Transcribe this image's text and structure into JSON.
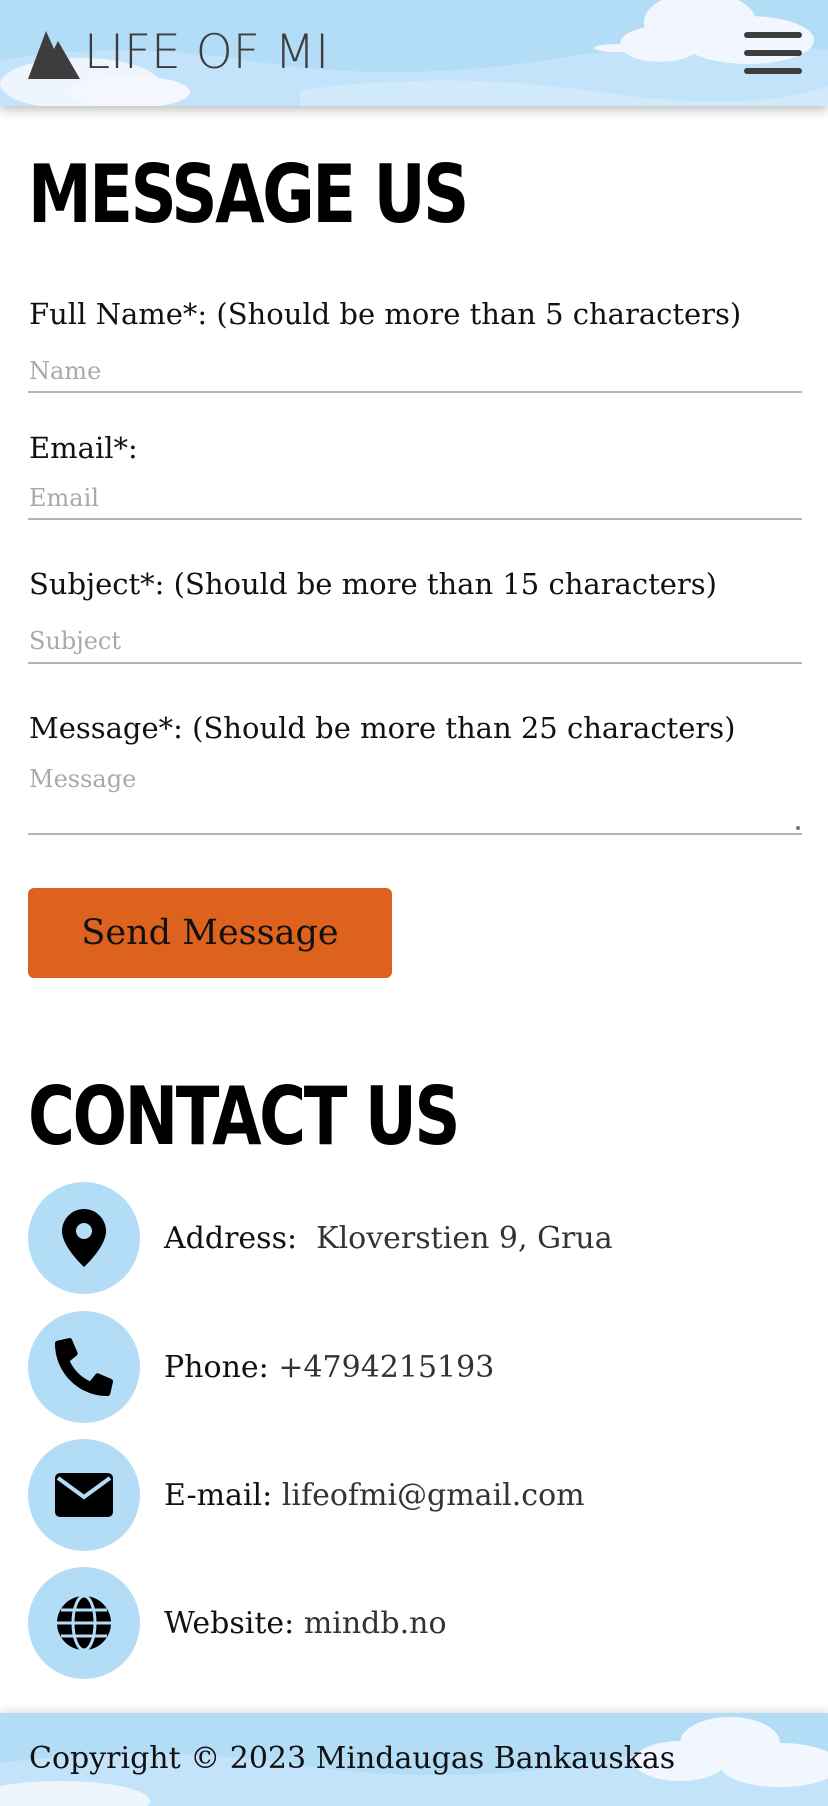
{
  "header": {
    "logo_text": "LIFE OF MI",
    "menu_icon": "hamburger-menu-icon",
    "background_color": "#b3dcf7"
  },
  "form": {
    "heading": "MESSAGE US",
    "name_label": "Full Name*: (Should be more than 5 characters)",
    "name_placeholder": "Name",
    "email_label": "Email*:",
    "email_placeholder": "Email",
    "subject_label": "Subject*: (Should be more than 15 characters)",
    "subject_placeholder": "Subject",
    "message_label": "Message*: (Should be more than 25 characters)",
    "message_placeholder": "Message",
    "submit_label": "Send Message",
    "submit_color": "#dc621d"
  },
  "contact": {
    "heading": "CONTACT US",
    "items": [
      {
        "icon": "map-pin-icon",
        "label": "Address:",
        "value": "Kloverstien 9, Grua"
      },
      {
        "icon": "phone-icon",
        "label": "Phone:",
        "value": "+4794215193"
      },
      {
        "icon": "envelope-icon",
        "label": "E-mail:",
        "value": "lifeofmi@gmail.com"
      },
      {
        "icon": "globe-icon",
        "label": "Website:",
        "value": "mindb.no"
      }
    ],
    "circle_color": "#b3dcf7"
  },
  "footer": {
    "copyright": "Copyright © 2023 Mindaugas Bankauskas"
  }
}
